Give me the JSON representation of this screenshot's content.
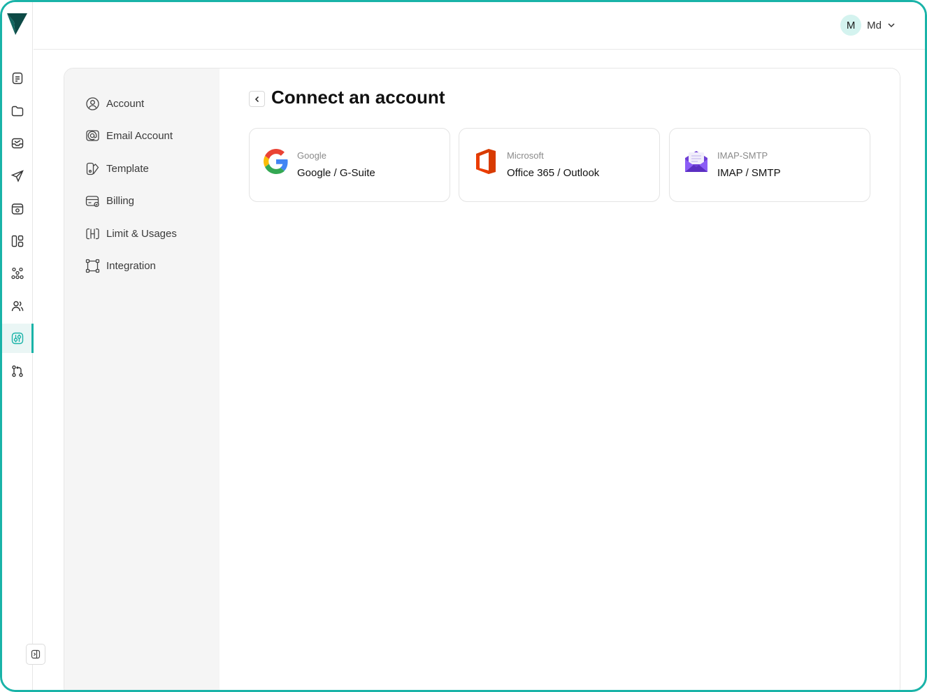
{
  "app": {
    "brand_color": "#19b3a8"
  },
  "rail": {
    "items": [
      {
        "icon": "document-icon"
      },
      {
        "icon": "folder-icon"
      },
      {
        "icon": "inbox-icon"
      },
      {
        "icon": "send-icon"
      },
      {
        "icon": "box-icon"
      },
      {
        "icon": "layout-icon"
      },
      {
        "icon": "network-icon"
      },
      {
        "icon": "users-icon"
      },
      {
        "icon": "settings-icon",
        "active": true
      },
      {
        "icon": "git-icon"
      }
    ]
  },
  "user": {
    "initial": "M",
    "name": "Md"
  },
  "settings_nav": {
    "items": [
      {
        "label": "Account",
        "icon": "user-circle-icon"
      },
      {
        "label": "Email Account",
        "icon": "email-at-icon"
      },
      {
        "label": "Template",
        "icon": "template-icon"
      },
      {
        "label": "Billing",
        "icon": "billing-icon"
      },
      {
        "label": "Limit & Usages",
        "icon": "limit-icon"
      },
      {
        "label": "Integration",
        "icon": "integration-icon"
      }
    ]
  },
  "main": {
    "title": "Connect an account",
    "providers": [
      {
        "provider": "Google",
        "name": "Google / G-Suite",
        "icon": "google-logo-icon"
      },
      {
        "provider": "Microsoft",
        "name": "Office 365 / Outlook",
        "icon": "office-logo-icon"
      },
      {
        "provider": "IMAP-SMTP",
        "name": "IMAP / SMTP",
        "icon": "mail-envelope-icon"
      }
    ]
  }
}
